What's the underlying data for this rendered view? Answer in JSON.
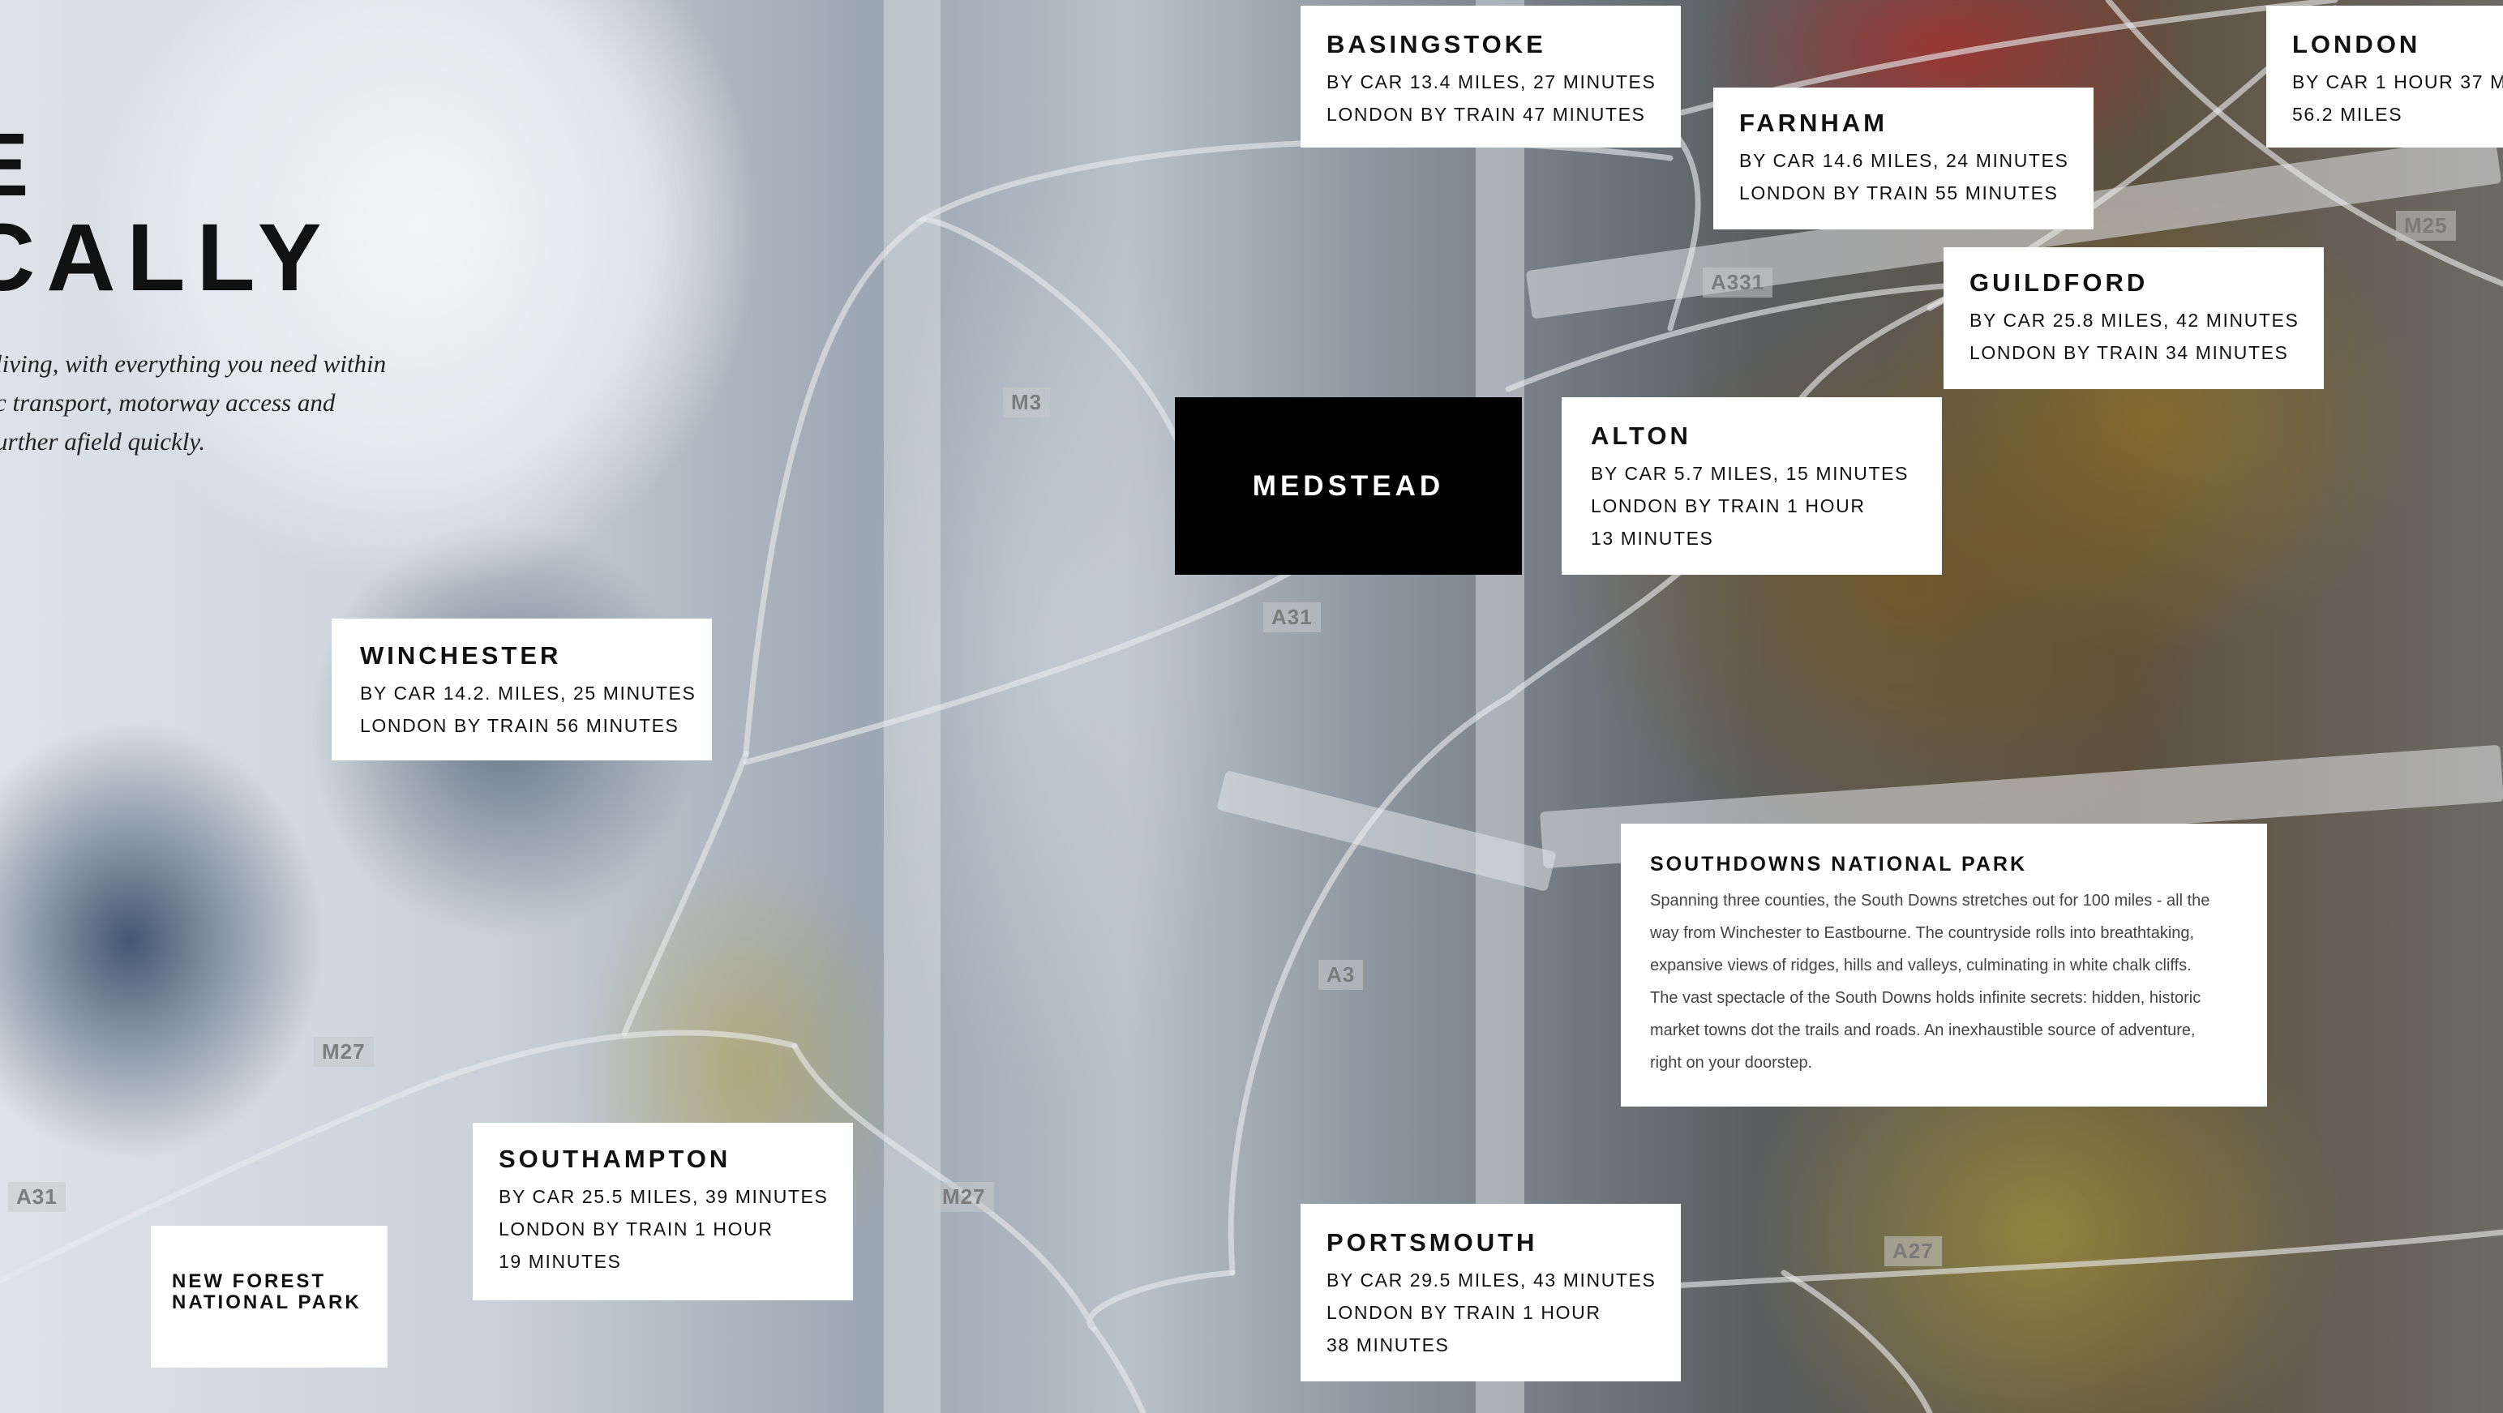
{
  "headline": {
    "line1": "E",
    "line2": "CALLY"
  },
  "intro": {
    "line1": "living, with everything you need within",
    "line2": "c transport, motorway access and",
    "line3": "urther afield quickly."
  },
  "center": {
    "name": "MEDSTEAD"
  },
  "destinations": {
    "basingstoke": {
      "name": "BASINGSTOKE",
      "car": "BY CAR 13.4 MILES, 27 MINUTES",
      "train": "LONDON BY TRAIN 47 MINUTES"
    },
    "farnham": {
      "name": "FARNHAM",
      "car": "BY CAR 14.6 MILES, 24 MINUTES",
      "train": "LONDON BY TRAIN 55 MINUTES"
    },
    "london": {
      "name": "LONDON",
      "car": "BY CAR 1 HOUR 37 MI",
      "train": "56.2 MILES"
    },
    "guildford": {
      "name": "GUILDFORD",
      "car": "BY CAR 25.8 MILES, 42 MINUTES",
      "train": "LONDON BY TRAIN 34 MINUTES"
    },
    "alton": {
      "name": "ALTON",
      "car": "BY CAR 5.7 MILES, 15 MINUTES",
      "train": "LONDON BY TRAIN 1 HOUR",
      "train2": "13 MINUTES"
    },
    "winchester": {
      "name": "WINCHESTER",
      "car": "BY CAR 14.2. MILES, 25 MINUTES",
      "train": "LONDON BY TRAIN 56 MINUTES"
    },
    "southampton": {
      "name": "SOUTHAMPTON",
      "car": "BY CAR 25.5 MILES, 39 MINUTES",
      "train": "LONDON BY TRAIN 1 HOUR",
      "train2": "19 MINUTES"
    },
    "portsmouth": {
      "name": "PORTSMOUTH",
      "car": "BY CAR 29.5 MILES, 43 MINUTES",
      "train": "LONDON BY TRAIN 1 HOUR",
      "train2": "38 MINUTES"
    }
  },
  "new_forest": {
    "line1": "NEW FOREST",
    "line2": "NATIONAL PARK"
  },
  "southdowns": {
    "title": "SOUTHDOWNS NATIONAL PARK",
    "lines": [
      "Spanning three counties, the South Downs stretches out for 100 miles - all the",
      "way from Winchester to Eastbourne. The countryside rolls into breathtaking,",
      "expansive views of ridges, hills and valleys, culminating in white chalk cliffs.",
      "The vast spectacle of the South Downs holds infinite secrets: hidden, historic",
      "market towns dot the trails and roads. An inexhaustible source of adventure,",
      "right on your doorstep."
    ]
  },
  "roads": {
    "m3": "M3",
    "a331": "A331",
    "m25": "M25",
    "a31_north": "A31",
    "a3": "A3",
    "m27_west": "M27",
    "m27_east": "M27",
    "a31_west": "A31",
    "a27": "A27"
  },
  "colors": {
    "card_background": "#ffffff",
    "center_background": "#000000",
    "route_line": "#e8eaec"
  }
}
